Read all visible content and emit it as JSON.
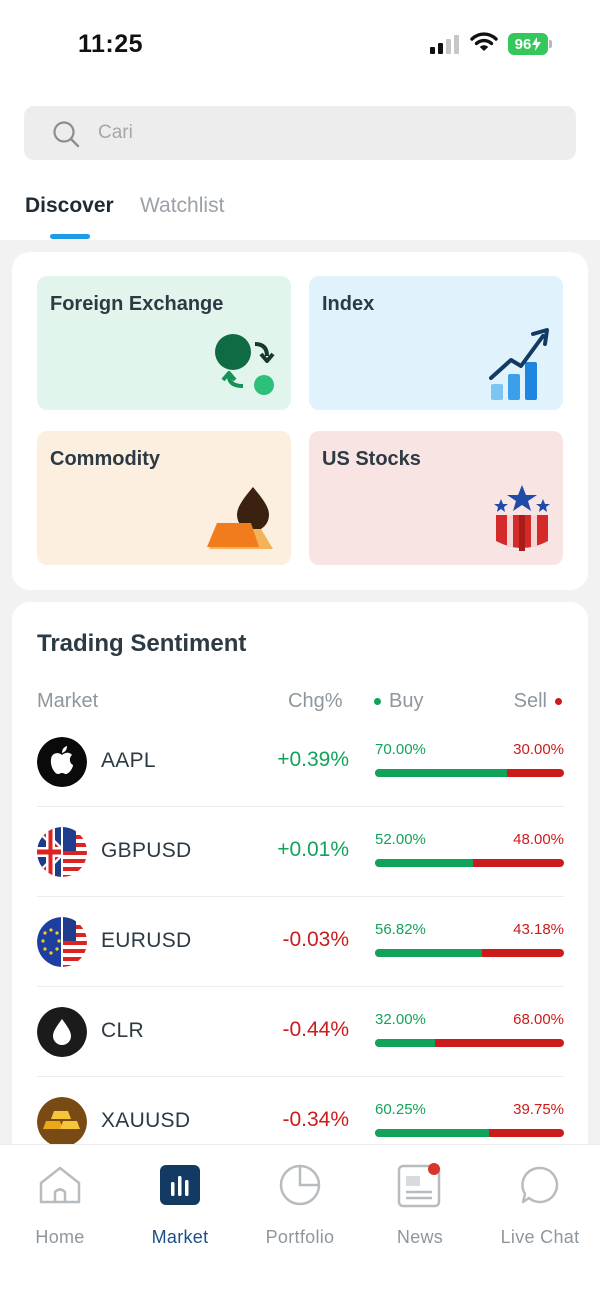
{
  "status_bar": {
    "time": "11:25",
    "battery": "96"
  },
  "search": {
    "placeholder": "Cari"
  },
  "tabs": [
    {
      "label": "Discover",
      "active": true
    },
    {
      "label": "Watchlist",
      "active": false
    }
  ],
  "categories": [
    {
      "label": "Foreign Exchange",
      "icon": "currency-exchange-icon"
    },
    {
      "label": "Index",
      "icon": "rising-chart-icon"
    },
    {
      "label": "Commodity",
      "icon": "gold-oil-icon"
    },
    {
      "label": "US Stocks",
      "icon": "us-stars-icon"
    }
  ],
  "sentiment": {
    "title": "Trading Sentiment",
    "headers": {
      "market": "Market",
      "chg": "Chg%",
      "buy": "Buy",
      "sell": "Sell"
    },
    "rows": [
      {
        "symbol": "AAPL",
        "chg": "+0.39%",
        "direction": "up",
        "buy": "70.00%",
        "sell": "30.00%",
        "buy_fraction": 0.7,
        "logo": "apple-logo-icon"
      },
      {
        "symbol": "GBPUSD",
        "chg": "+0.01%",
        "direction": "up",
        "buy": "52.00%",
        "sell": "48.00%",
        "buy_fraction": 0.52,
        "logo": "gb-us-flag-icon"
      },
      {
        "symbol": "EURUSD",
        "chg": "-0.03%",
        "direction": "down",
        "buy": "56.82%",
        "sell": "43.18%",
        "buy_fraction": 0.5682,
        "logo": "eu-us-flag-icon"
      },
      {
        "symbol": "CLR",
        "chg": "-0.44%",
        "direction": "down",
        "buy": "32.00%",
        "sell": "68.00%",
        "buy_fraction": 0.32,
        "logo": "oil-drop-icon"
      },
      {
        "symbol": "XAUUSD",
        "chg": "-0.34%",
        "direction": "down",
        "buy": "60.25%",
        "sell": "39.75%",
        "buy_fraction": 0.6025,
        "logo": "gold-bars-icon"
      }
    ]
  },
  "nav": [
    {
      "label": "Home",
      "icon": "home-icon",
      "active": false
    },
    {
      "label": "Market",
      "icon": "market-chart-icon",
      "active": true
    },
    {
      "label": "Portfolio",
      "icon": "pie-chart-icon",
      "active": false
    },
    {
      "label": "News",
      "icon": "newspaper-icon",
      "active": false,
      "badge": true
    },
    {
      "label": "Live Chat",
      "icon": "chat-bubble-icon",
      "active": false
    }
  ],
  "colors": {
    "positive": "#12a35a",
    "negative": "#cc1b1b",
    "accent": "#1e9be6",
    "nav_active": "#1c4f85"
  }
}
